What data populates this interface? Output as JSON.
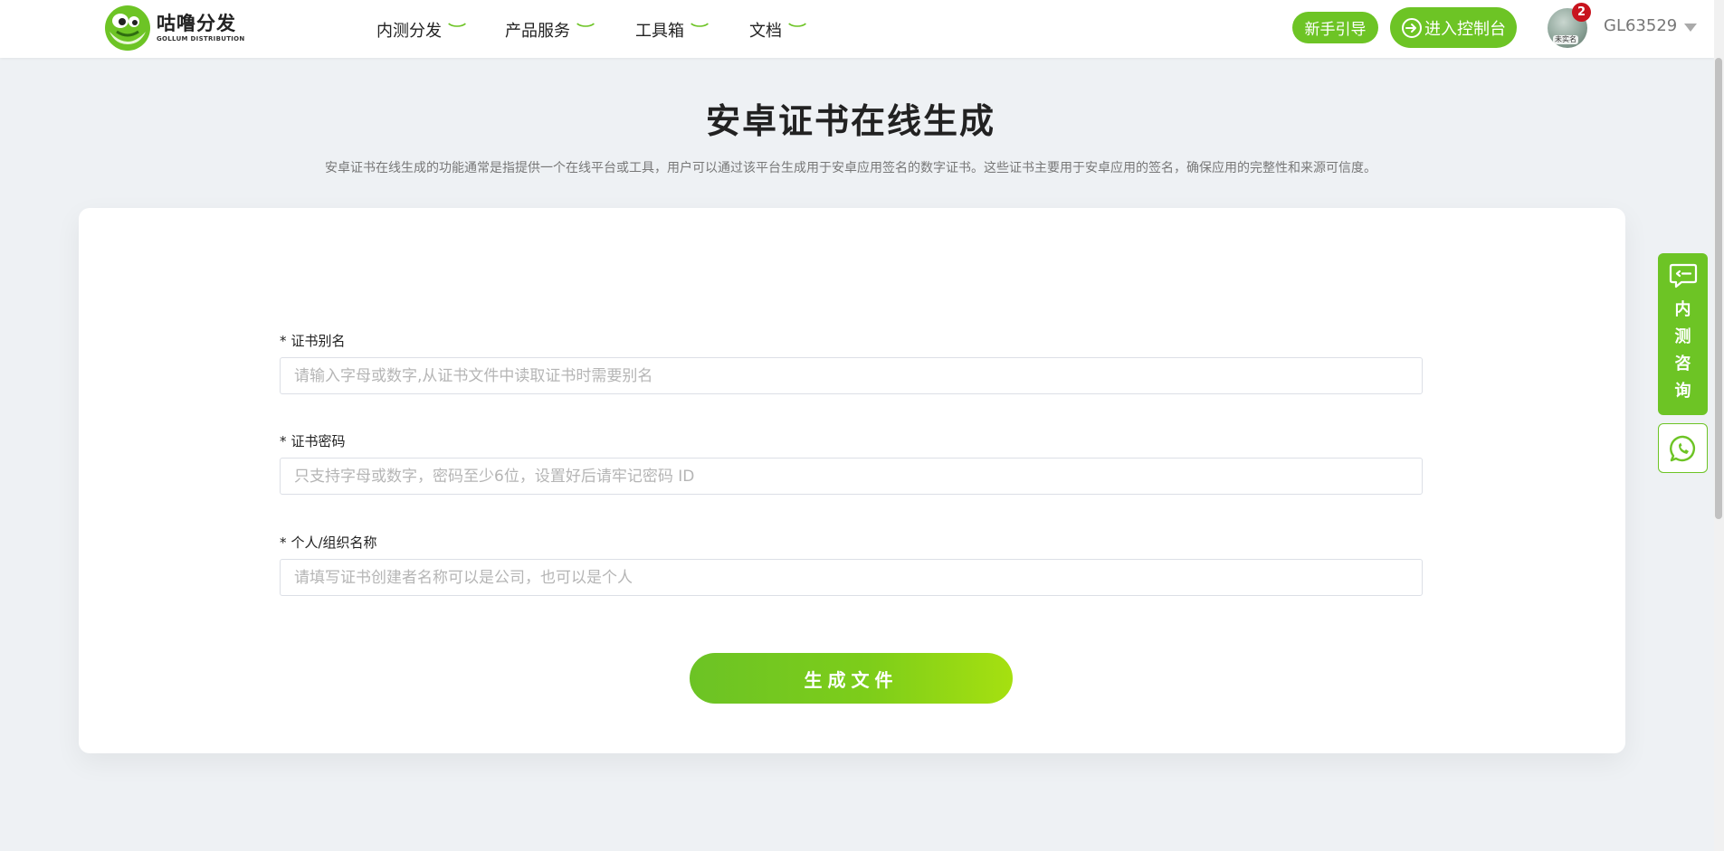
{
  "header": {
    "logo": {
      "name": "咕噜分发",
      "subtitle": "GOLLUM DISTRIBUTION"
    },
    "nav": [
      {
        "label": "内测分发",
        "icon": "chevron-down-icon"
      },
      {
        "label": "产品服务",
        "icon": "chevron-down-icon"
      },
      {
        "label": "工具箱",
        "icon": "chevron-down-icon"
      },
      {
        "label": "文档",
        "icon": "chevron-down-icon"
      }
    ],
    "guide_button": "新手引导",
    "console_button": "进入控制台",
    "console_icon": "login-icon",
    "notification_count": "2",
    "avatar_tag": "未实名",
    "username": "GL63529"
  },
  "page": {
    "title": "安卓证书在线生成",
    "description": "安卓证书在线生成的功能通常是指提供一个在线平台或工具，用户可以通过该平台生成用于安卓应用签名的数字证书。这些证书主要用于安卓应用的签名，确保应用的完整性和来源可信度。"
  },
  "form": {
    "fields": [
      {
        "required_mark": "*",
        "label": "证书别名",
        "value": "",
        "placeholder": "请输入字母或数字,从证书文件中读取证书时需要别名"
      },
      {
        "required_mark": "*",
        "label": "证书密码",
        "value": "",
        "placeholder": "只支持字母或数字，密码至少6位，设置好后请牢记密码 ID"
      },
      {
        "required_mark": "*",
        "label": "个人/组织名称",
        "value": "",
        "placeholder": "请填写证书创建者名称可以是公司，也可以是个人"
      }
    ],
    "submit_label": "生成文件"
  },
  "sidebar": {
    "consult_label": "内测咨询",
    "consult_icon": "message-icon",
    "chat_icon": "whatsapp-icon"
  },
  "colors": {
    "brand_green": "#6dc425",
    "gradient_end": "#a6e010",
    "badge_red": "#c8141e",
    "background": "#eef1f4"
  }
}
